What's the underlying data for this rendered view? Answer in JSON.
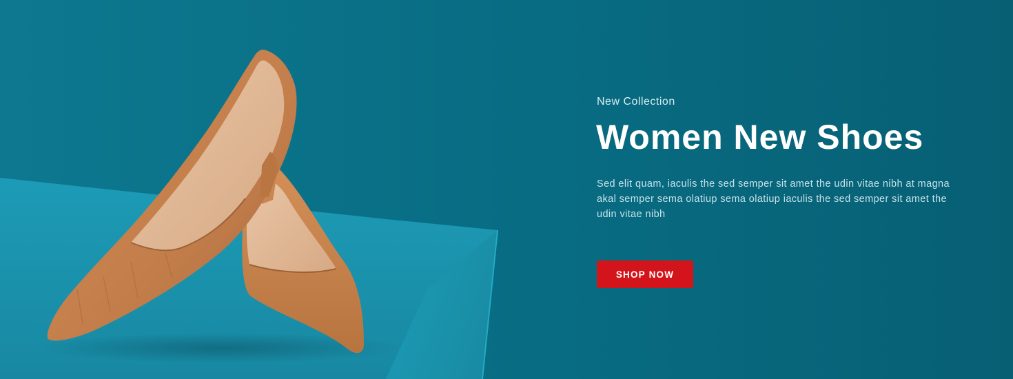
{
  "hero": {
    "eyebrow": "New Collection",
    "headline": "Women New Shoes",
    "description": "Sed elit quam, iaculis the sed semper sit amet the udin vitae nibh at magna akal semper sema olatiup sema olatiup iaculis the sed semper sit amet the udin vitae nibh",
    "cta_label": "SHOP NOW"
  },
  "colors": {
    "background": "#086a80",
    "pedestal": "#1b9ab5",
    "shoe": "#c98450",
    "cta": "#d4141b",
    "text": "#ffffff"
  },
  "image": {
    "subject": "tan leather pointed-toe pumps on teal pedestal"
  }
}
